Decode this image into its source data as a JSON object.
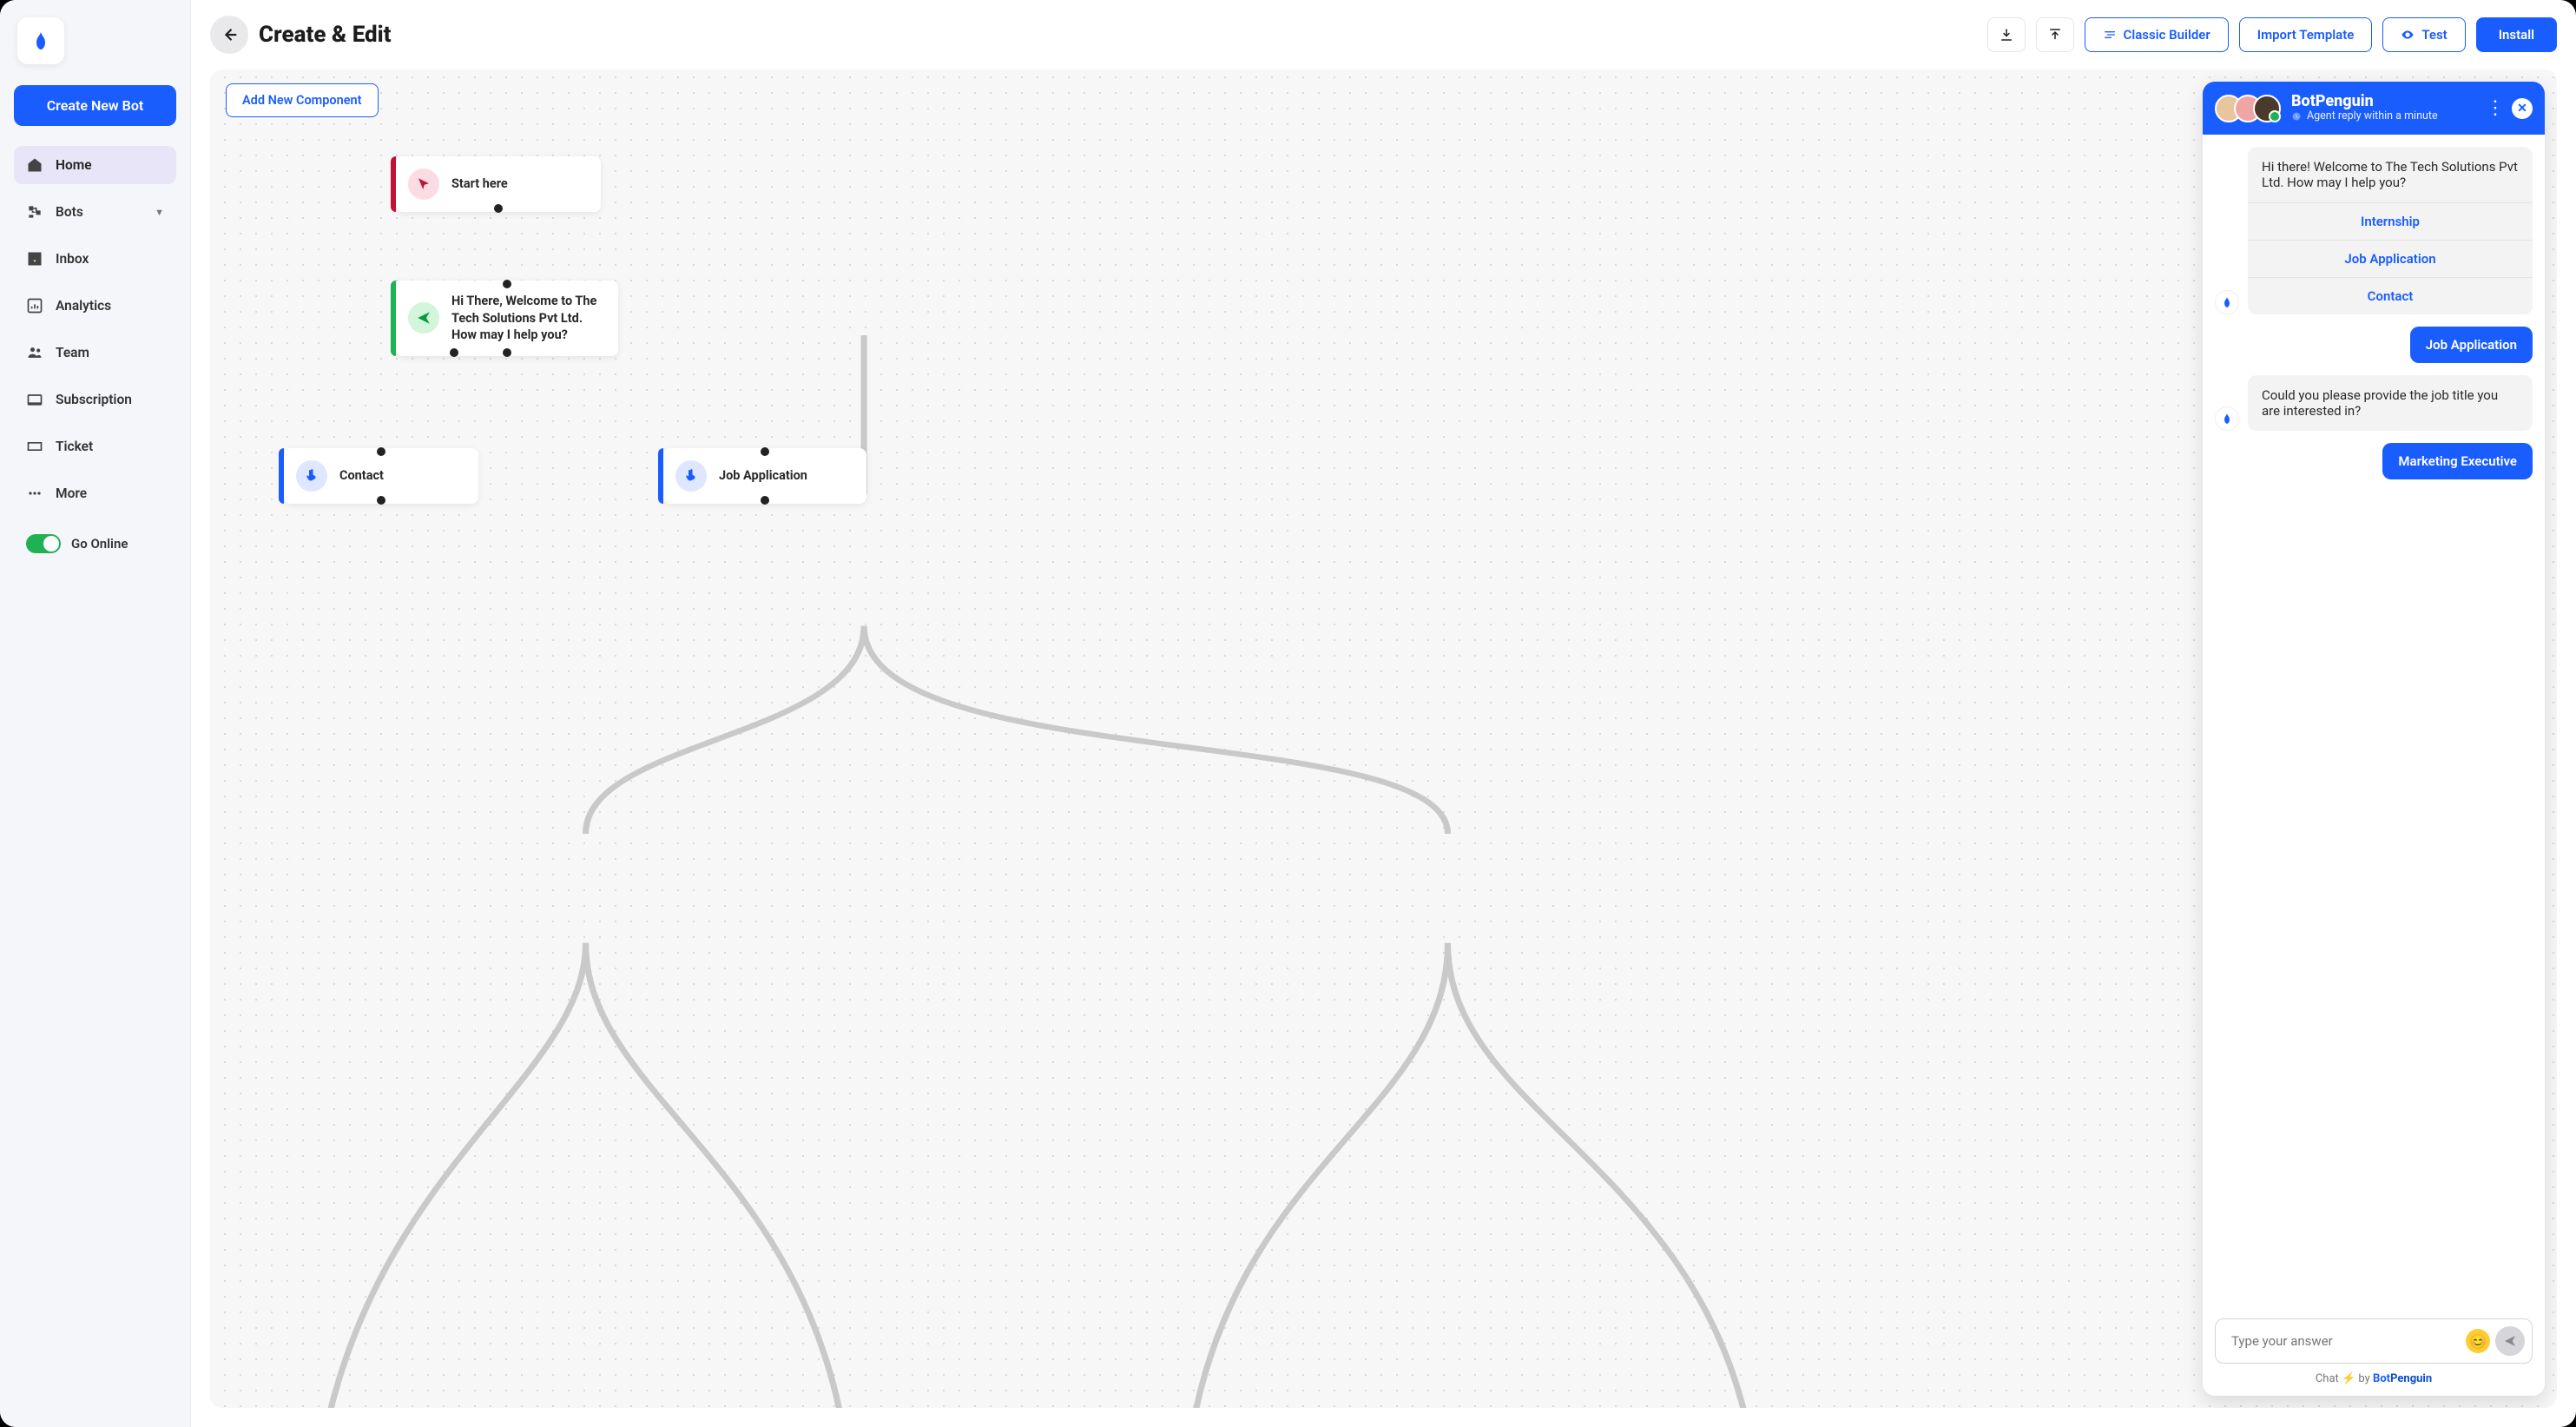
{
  "sidebar": {
    "create_label": "Create New Bot",
    "items": [
      {
        "icon": "home",
        "label": "Home"
      },
      {
        "icon": "bots",
        "label": "Bots",
        "expandable": true
      },
      {
        "icon": "inbox",
        "label": "Inbox"
      },
      {
        "icon": "analytics",
        "label": "Analytics"
      },
      {
        "icon": "team",
        "label": "Team"
      },
      {
        "icon": "subscription",
        "label": "Subscription"
      },
      {
        "icon": "ticket",
        "label": "Ticket"
      },
      {
        "icon": "more",
        "label": "More"
      }
    ],
    "toggle_label": "Go Online"
  },
  "toolbar": {
    "page_title": "Create & Edit",
    "classic_builder": "Classic Builder",
    "import_template": "Import Template",
    "test": "Test",
    "install": "Install"
  },
  "canvas": {
    "add_component": "Add New Component",
    "nodes": {
      "start": "Start here",
      "welcome": "Hi There, Welcome to The Tech Solutions Pvt Ltd. How may I help you?",
      "contact": "Contact",
      "jobapp": "Job Application"
    }
  },
  "chat": {
    "title": "BotPenguin",
    "subtitle": "Agent reply within a minute",
    "messages": {
      "welcome": "Hi there! Welcome to The Tech Solutions Pvt Ltd. How may I help you?",
      "opt_internship": "Internship",
      "opt_jobapp": "Job Application",
      "opt_contact": "Contact",
      "user_choice": "Job Application",
      "followup": "Could you please provide the job title you are interested in?",
      "user_reply": "Marketing Executive"
    },
    "input_placeholder": "Type your answer",
    "footer_pre": "Chat ",
    "footer_by": " by ",
    "footer_brand_a": "Bot",
    "footer_brand_b": "Penguin"
  }
}
